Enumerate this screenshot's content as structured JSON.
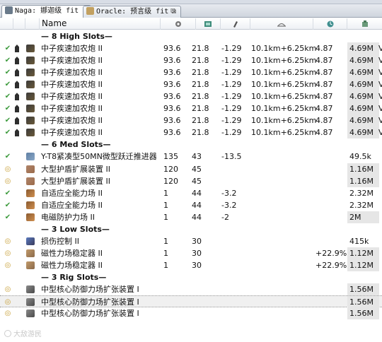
{
  "tabs": [
    {
      "label": "Naga: 娜迦级 fit",
      "active": true
    },
    {
      "label": "Oracle: 预言级 fit",
      "active": false
    }
  ],
  "columns": {
    "name": "Name",
    "icons": [
      "cpu-icon",
      "powergrid-icon",
      "damage-icon",
      "range-icon",
      "rate-icon",
      "price-icon"
    ]
  },
  "rows": [
    {
      "type": "header",
      "label": "— 8 High Slots—"
    },
    {
      "type": "module",
      "state": "online",
      "icon": "gun",
      "name": "中子疾速加农炮 II",
      "v": [
        "93.6",
        "21.8",
        "-1.29",
        "10.1km+6.25km",
        "4.87",
        "4.69M",
        "V"
      ]
    },
    {
      "type": "module",
      "state": "online",
      "icon": "gun",
      "name": "中子疾速加农炮 II",
      "v": [
        "93.6",
        "21.8",
        "-1.29",
        "10.1km+6.25km",
        "4.87",
        "4.69M",
        "V"
      ]
    },
    {
      "type": "module",
      "state": "online",
      "icon": "gun",
      "name": "中子疾速加农炮 II",
      "v": [
        "93.6",
        "21.8",
        "-1.29",
        "10.1km+6.25km",
        "4.87",
        "4.69M",
        "V"
      ]
    },
    {
      "type": "module",
      "state": "online",
      "icon": "gun",
      "name": "中子疾速加农炮 II",
      "v": [
        "93.6",
        "21.8",
        "-1.29",
        "10.1km+6.25km",
        "4.87",
        "4.69M",
        "V"
      ]
    },
    {
      "type": "module",
      "state": "online",
      "icon": "gun",
      "name": "中子疾速加农炮 II",
      "v": [
        "93.6",
        "21.8",
        "-1.29",
        "10.1km+6.25km",
        "4.87",
        "4.69M",
        "V"
      ]
    },
    {
      "type": "module",
      "state": "online",
      "icon": "gun",
      "name": "中子疾速加农炮 II",
      "v": [
        "93.6",
        "21.8",
        "-1.29",
        "10.1km+6.25km",
        "4.87",
        "4.69M",
        "V"
      ]
    },
    {
      "type": "module",
      "state": "online",
      "icon": "gun",
      "name": "中子疾速加农炮 II",
      "v": [
        "93.6",
        "21.8",
        "-1.29",
        "10.1km+6.25km",
        "4.87",
        "4.69M",
        "V"
      ]
    },
    {
      "type": "module",
      "state": "online",
      "icon": "gun",
      "name": "中子疾速加农炮 II",
      "v": [
        "93.6",
        "21.8",
        "-1.29",
        "10.1km+6.25km",
        "4.87",
        "4.69M",
        "V"
      ]
    },
    {
      "type": "header",
      "label": "— 6 Med Slots—"
    },
    {
      "type": "module",
      "state": "online",
      "icon": "mwd",
      "name": "Y-T8紧凑型50MN微型跃迁推进器",
      "v": [
        "135",
        "43",
        "-13.5",
        "",
        "",
        "49.5k",
        ""
      ]
    },
    {
      "type": "module",
      "state": "offline",
      "icon": "shield",
      "name": "大型护盾扩展装置 II",
      "v": [
        "120",
        "45",
        "",
        "",
        "",
        "1.16M",
        ""
      ]
    },
    {
      "type": "module",
      "state": "offline",
      "icon": "shield",
      "name": "大型护盾扩展装置 II",
      "v": [
        "120",
        "45",
        "",
        "",
        "",
        "1.16M",
        ""
      ]
    },
    {
      "type": "module",
      "state": "online",
      "icon": "hardener",
      "name": "自适应全能力场 II",
      "v": [
        "1",
        "44",
        "-3.2",
        "",
        "",
        "2.32M",
        ""
      ]
    },
    {
      "type": "module",
      "state": "online",
      "icon": "hardener",
      "name": "自适应全能力场 II",
      "v": [
        "1",
        "44",
        "-3.2",
        "",
        "",
        "2.32M",
        ""
      ]
    },
    {
      "type": "module",
      "state": "online",
      "icon": "hardener",
      "name": "电磁防护力场 II",
      "v": [
        "1",
        "44",
        "-2",
        "",
        "",
        "2M",
        ""
      ]
    },
    {
      "type": "header",
      "label": "— 3 Low Slots—"
    },
    {
      "type": "module",
      "state": "offline",
      "icon": "dc",
      "name": "损伤控制 II",
      "v": [
        "1",
        "30",
        "",
        "",
        "",
        "415k",
        ""
      ]
    },
    {
      "type": "module",
      "state": "offline",
      "icon": "mfs",
      "name": "磁性力场稳定器 II",
      "v": [
        "1",
        "30",
        "",
        "",
        "+22.9%",
        "1.12M",
        ""
      ]
    },
    {
      "type": "module",
      "state": "offline",
      "icon": "mfs",
      "name": "磁性力场稳定器 II",
      "v": [
        "1",
        "30",
        "",
        "",
        "+22.9%",
        "1.12M",
        ""
      ]
    },
    {
      "type": "header",
      "label": "— 3 Rig Slots—"
    },
    {
      "type": "module",
      "state": "offline",
      "icon": "rig",
      "name": "中型核心防御力场扩张装置 I",
      "v": [
        "",
        "",
        "",
        "",
        "",
        "1.56M",
        ""
      ]
    },
    {
      "type": "module",
      "state": "offline",
      "icon": "rig",
      "name": "中型核心防御力场扩张装置 I",
      "v": [
        "",
        "",
        "",
        "",
        "",
        "1.56M",
        ""
      ],
      "highlight": true
    },
    {
      "type": "module",
      "state": "offline",
      "icon": "rig",
      "name": "中型核心防御力场扩张装置 I",
      "v": [
        "",
        "",
        "",
        "",
        "",
        "1.56M",
        ""
      ]
    }
  ],
  "colors": {
    "online": "#3c9a3c",
    "offline": "#c9a13a",
    "priceShade": "#e6e6e6"
  },
  "watermark": "大敌游民"
}
